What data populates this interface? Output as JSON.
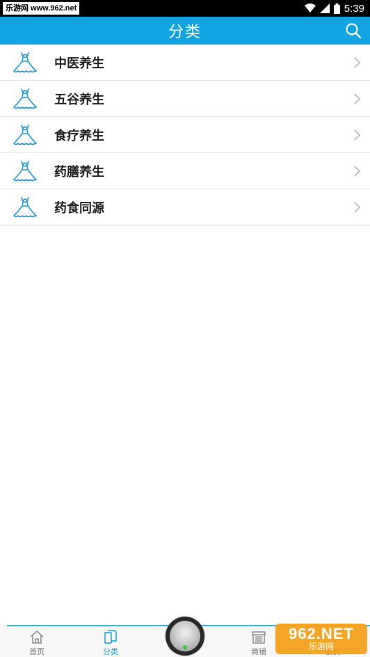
{
  "status_bar": {
    "left_text": "乐游网 www.962.net",
    "time": "5:39"
  },
  "header": {
    "title": "分类",
    "search_icon": "search-icon"
  },
  "categories": [
    {
      "label": "中医养生",
      "icon": "dress-icon"
    },
    {
      "label": "五谷养生",
      "icon": "dress-icon"
    },
    {
      "label": "食疗养生",
      "icon": "dress-icon"
    },
    {
      "label": "药膳养生",
      "icon": "dress-icon"
    },
    {
      "label": "药食同源",
      "icon": "dress-icon"
    }
  ],
  "tabbar": {
    "home": "首页",
    "category": "分类",
    "shop": "商铺",
    "member": "会员"
  },
  "watermark": {
    "top": "962.NET",
    "bottom": "乐游网"
  },
  "colors": {
    "accent": "#12a3e3",
    "icon": "#1a9cd8"
  }
}
